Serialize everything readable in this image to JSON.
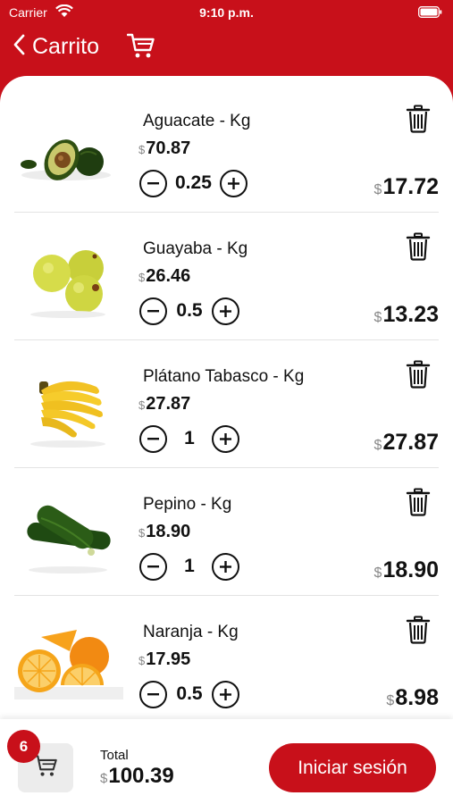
{
  "status_bar": {
    "carrier": "Carrier",
    "time": "9:10 p.m."
  },
  "nav": {
    "back_label": "Carrito",
    "icons": [
      "chevron-left-icon",
      "cart-icon"
    ]
  },
  "currency_symbol": "$",
  "cart": {
    "items": [
      {
        "name": "Aguacate - Kg",
        "price": "70.87",
        "quantity": "0.25",
        "subtotal": "17.72",
        "image": "avocado"
      },
      {
        "name": "Guayaba - Kg",
        "price": "26.46",
        "quantity": "0.5",
        "subtotal": "13.23",
        "image": "guava"
      },
      {
        "name": "Plátano Tabasco - Kg",
        "price": "27.87",
        "quantity": "1",
        "subtotal": "27.87",
        "image": "banana"
      },
      {
        "name": "Pepino - Kg",
        "price": "18.90",
        "quantity": "1",
        "subtotal": "18.90",
        "image": "cucumber"
      },
      {
        "name": "Naranja - Kg",
        "price": "17.95",
        "quantity": "0.5",
        "subtotal": "8.98",
        "image": "orange"
      }
    ]
  },
  "footer": {
    "cart_count": "6",
    "total_label": "Total",
    "total_value": "100.39",
    "login_label": "Iniciar sesión"
  },
  "colors": {
    "brand": "#c8101a",
    "text": "#111111",
    "muted": "#888888",
    "divider": "#e3e3e3"
  }
}
